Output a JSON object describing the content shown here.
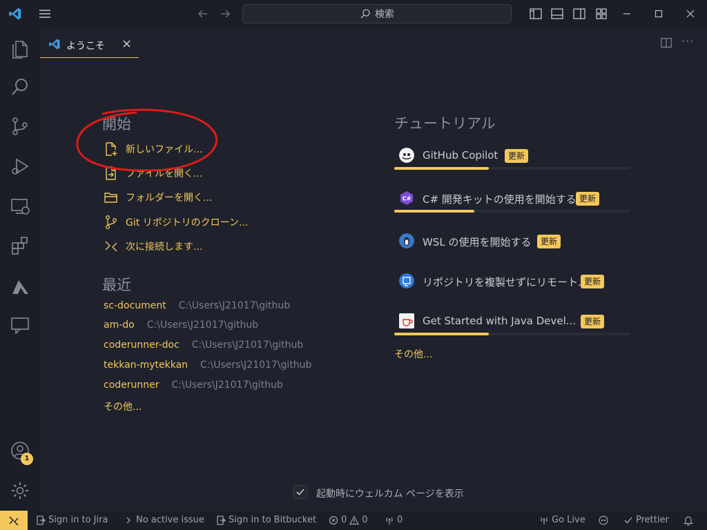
{
  "titlebar": {
    "search_placeholder": "検索",
    "icons": [
      "vscode-logo-icon",
      "menu-icon",
      "back-arrow-icon",
      "forward-arrow-icon",
      "toggle-primary-sidebar-icon",
      "toggle-panel-icon",
      "toggle-secondary-sidebar-icon",
      "customize-layout-icon",
      "minimize-icon",
      "maximize-icon",
      "close-window-icon"
    ]
  },
  "tab": {
    "label": "ようこそ",
    "close": "×"
  },
  "start": {
    "heading": "開始",
    "items": [
      {
        "label": "新しいファイル...",
        "icon": "new-file-icon"
      },
      {
        "label": "ファイルを開く...",
        "icon": "open-file-icon"
      },
      {
        "label": "フォルダーを開く...",
        "icon": "open-folder-icon"
      },
      {
        "label": "Git リポジトリのクローン...",
        "icon": "git-clone-icon"
      },
      {
        "label": "次に接続します...",
        "icon": "remote-connect-icon"
      }
    ]
  },
  "recent": {
    "heading": "最近",
    "items": [
      {
        "name": "sc-document",
        "path": "C:\\Users\\J21017\\github"
      },
      {
        "name": "am-do",
        "path": "C:\\Users\\J21017\\github"
      },
      {
        "name": "coderunner-doc",
        "path": "C:\\Users\\J21017\\github"
      },
      {
        "name": "tekkan-mytekkan",
        "path": "C:\\Users\\J21017\\github"
      },
      {
        "name": "coderunner",
        "path": "C:\\Users\\J21017\\github"
      }
    ],
    "more": "その他..."
  },
  "tutorials": {
    "heading": "チュートリアル",
    "items": [
      {
        "title": "GitHub Copilot",
        "badge": "更新",
        "progress": 0.4,
        "icon": "copilot-icon"
      },
      {
        "title": "C# 開発キットの使用を開始する",
        "badge": "更新",
        "progress": 0.34,
        "icon": "csharp-icon"
      },
      {
        "title": "WSL の使用を開始する",
        "badge": "更新",
        "progress": 0,
        "icon": "linux-penguin-icon"
      },
      {
        "title": "リポジトリを複製せずにリモート...",
        "badge": "更新",
        "progress": 0,
        "icon": "remote-repo-icon"
      },
      {
        "title": "Get Started with Java Devel...",
        "badge": "更新",
        "progress": 0.4,
        "icon": "java-cup-icon"
      }
    ],
    "more": "その他..."
  },
  "footer": {
    "show_welcome_label": "起動時にウェルカム ページを表示",
    "show_welcome_checked": true
  },
  "statusbar": {
    "jira": "Sign in to Jira",
    "issue": "No active issue",
    "bitbucket": "Sign in to Bitbucket",
    "errors": "0",
    "warnings": "0",
    "ports": "0",
    "golive": "Go Live",
    "prettier": "Prettier"
  },
  "accounts_badge": "1",
  "colors": {
    "accent": "#f3c75b",
    "background": "#1f222c",
    "bar": "#1b1e26"
  }
}
